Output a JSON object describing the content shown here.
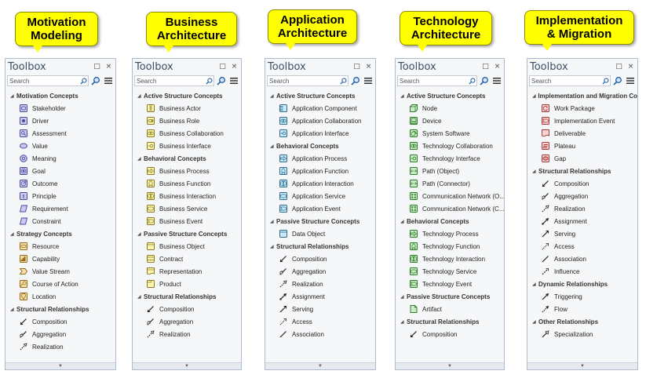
{
  "callouts": [
    "Motivation\nModeling",
    "Business\nArchitecture",
    "Application\nArchitecture",
    "Technology\nArchitecture",
    "Implementation\n& Migration"
  ],
  "toolbox": {
    "title": "Toolbox",
    "search_placeholder": "Search",
    "restore_glyph": "□",
    "close_glyph": "×",
    "expand_glyph": "◢",
    "scroll_glyph": "▼"
  },
  "panels": [
    {
      "sections": [
        {
          "label": "Motivation Concepts",
          "items": [
            {
              "label": "Stakeholder",
              "icon": "stakeholder-icon"
            },
            {
              "label": "Driver",
              "icon": "driver-icon"
            },
            {
              "label": "Assessment",
              "icon": "assessment-icon"
            },
            {
              "label": "Value",
              "icon": "value-icon"
            },
            {
              "label": "Meaning",
              "icon": "meaning-icon"
            },
            {
              "label": "Goal",
              "icon": "goal-icon"
            },
            {
              "label": "Outcome",
              "icon": "outcome-icon"
            },
            {
              "label": "Principle",
              "icon": "principle-icon"
            },
            {
              "label": "Requirement",
              "icon": "requirement-icon"
            },
            {
              "label": "Constraint",
              "icon": "constraint-icon"
            }
          ]
        },
        {
          "label": "Strategy Concepts",
          "items": [
            {
              "label": "Resource",
              "icon": "resource-icon"
            },
            {
              "label": "Capability",
              "icon": "capability-icon"
            },
            {
              "label": "Value Stream",
              "icon": "value-stream-icon"
            },
            {
              "label": "Course of Action",
              "icon": "course-of-action-icon"
            },
            {
              "label": "Location",
              "icon": "location-icon"
            }
          ]
        },
        {
          "label": "Structural Relationships",
          "items": [
            {
              "label": "Composition",
              "icon": "composition-icon"
            },
            {
              "label": "Aggregation",
              "icon": "aggregation-icon"
            },
            {
              "label": "Realization",
              "icon": "realization-icon"
            }
          ]
        }
      ]
    },
    {
      "sections": [
        {
          "label": "Active Structure Concepts",
          "items": [
            {
              "label": "Business Actor",
              "icon": "actor-icon"
            },
            {
              "label": "Business Role",
              "icon": "role-icon"
            },
            {
              "label": "Business Collaboration",
              "icon": "collaboration-icon"
            },
            {
              "label": "Business Interface",
              "icon": "interface-icon"
            }
          ]
        },
        {
          "label": "Behavioral Concepts",
          "items": [
            {
              "label": "Business Process",
              "icon": "process-icon"
            },
            {
              "label": "Business Function",
              "icon": "function-icon"
            },
            {
              "label": "Business Interaction",
              "icon": "interaction-icon"
            },
            {
              "label": "Business Service",
              "icon": "service-icon"
            },
            {
              "label": "Business Event",
              "icon": "event-icon"
            }
          ]
        },
        {
          "label": "Passive Structure Concepts",
          "items": [
            {
              "label": "Business Object",
              "icon": "object-icon"
            },
            {
              "label": "Contract",
              "icon": "contract-icon"
            },
            {
              "label": "Representation",
              "icon": "representation-icon"
            },
            {
              "label": "Product",
              "icon": "product-icon"
            }
          ]
        },
        {
          "label": "Structural Relationships",
          "items": [
            {
              "label": "Composition",
              "icon": "composition-icon"
            },
            {
              "label": "Aggregation",
              "icon": "aggregation-icon"
            },
            {
              "label": "Realization",
              "icon": "realization-icon"
            }
          ]
        }
      ]
    },
    {
      "sections": [
        {
          "label": "Active Structure Concepts",
          "items": [
            {
              "label": "Application Component",
              "icon": "component-icon"
            },
            {
              "label": "Application Collaboration",
              "icon": "collaboration-icon"
            },
            {
              "label": "Application Interface",
              "icon": "interface-icon"
            }
          ]
        },
        {
          "label": "Behavioral Concepts",
          "items": [
            {
              "label": "Application Process",
              "icon": "process-icon"
            },
            {
              "label": "Application Function",
              "icon": "function-icon"
            },
            {
              "label": "Application Interaction",
              "icon": "interaction-icon"
            },
            {
              "label": "Application Service",
              "icon": "service-icon"
            },
            {
              "label": "Application Event",
              "icon": "event-icon"
            }
          ]
        },
        {
          "label": "Passive Structure Concepts",
          "items": [
            {
              "label": "Data Object",
              "icon": "object-icon"
            }
          ]
        },
        {
          "label": "Structural Relationships",
          "items": [
            {
              "label": "Composition",
              "icon": "composition-icon"
            },
            {
              "label": "Aggregation",
              "icon": "aggregation-icon"
            },
            {
              "label": "Realization",
              "icon": "realization-icon"
            },
            {
              "label": "Assignment",
              "icon": "assignment-icon"
            },
            {
              "label": "Serving",
              "icon": "serving-icon"
            },
            {
              "label": "Access",
              "icon": "access-icon"
            },
            {
              "label": "Association",
              "icon": "association-icon"
            }
          ]
        }
      ]
    },
    {
      "sections": [
        {
          "label": "Active Structure Concepts",
          "items": [
            {
              "label": "Node",
              "icon": "node-icon"
            },
            {
              "label": "Device",
              "icon": "device-icon"
            },
            {
              "label": "System Software",
              "icon": "system-software-icon"
            },
            {
              "label": "Technology Collaboration",
              "icon": "collaboration-icon"
            },
            {
              "label": "Technology Interface",
              "icon": "interface-icon"
            },
            {
              "label": "Path (Object)",
              "icon": "path-icon"
            },
            {
              "label": "Path (Connector)",
              "icon": "path-icon"
            },
            {
              "label": "Communication Network (O...",
              "icon": "network-icon"
            },
            {
              "label": "Communication Network (C...",
              "icon": "network-icon"
            }
          ]
        },
        {
          "label": "Behavioral Concepts",
          "items": [
            {
              "label": "Technology Process",
              "icon": "process-icon"
            },
            {
              "label": "Technology Function",
              "icon": "function-icon"
            },
            {
              "label": "Technology Interaction",
              "icon": "interaction-icon"
            },
            {
              "label": "Technology Service",
              "icon": "service-icon"
            },
            {
              "label": "Technology Event",
              "icon": "event-icon"
            }
          ]
        },
        {
          "label": "Passive Structure Concepts",
          "items": [
            {
              "label": "Artifact",
              "icon": "artifact-icon"
            }
          ]
        },
        {
          "label": "Structural Relationships",
          "items": [
            {
              "label": "Composition",
              "icon": "composition-icon"
            }
          ]
        }
      ]
    },
    {
      "sections": [
        {
          "label": "Implementation and Migration Co",
          "items": [
            {
              "label": "Work Package",
              "icon": "work-package-icon"
            },
            {
              "label": "Implementation Event",
              "icon": "event-icon"
            },
            {
              "label": "Deliverable",
              "icon": "deliverable-icon"
            },
            {
              "label": "Plateau",
              "icon": "plateau-icon"
            },
            {
              "label": "Gap",
              "icon": "gap-icon"
            }
          ]
        },
        {
          "label": "Structural Relationships",
          "items": [
            {
              "label": "Composition",
              "icon": "composition-icon"
            },
            {
              "label": "Aggregation",
              "icon": "aggregation-icon"
            },
            {
              "label": "Realization",
              "icon": "realization-icon"
            },
            {
              "label": "Assignment",
              "icon": "assignment-icon"
            },
            {
              "label": "Serving",
              "icon": "serving-icon"
            },
            {
              "label": "Access",
              "icon": "access-icon"
            },
            {
              "label": "Association",
              "icon": "association-icon"
            },
            {
              "label": "Influence",
              "icon": "influence-icon"
            }
          ]
        },
        {
          "label": "Dynamic Relationships",
          "items": [
            {
              "label": "Triggering",
              "icon": "triggering-icon"
            },
            {
              "label": "Flow",
              "icon": "flow-icon"
            }
          ]
        },
        {
          "label": "Other Relationships",
          "items": [
            {
              "label": "Specialization",
              "icon": "specialization-icon"
            }
          ]
        }
      ]
    }
  ],
  "colors": {
    "motivation": "#c9c9f2",
    "motivation_stroke": "#4b4b9a",
    "strategy": "#f5dfa6",
    "strategy_stroke": "#9a6d1a",
    "business": "#fff6b5",
    "business_stroke": "#8a7a1a",
    "application": "#cde9f7",
    "application_stroke": "#2a6f93",
    "technology": "#c8edc1",
    "technology_stroke": "#2e7a2e",
    "implementation": "#fbd5d5",
    "implementation_stroke": "#a53a3a",
    "relationship": "#222222"
  }
}
